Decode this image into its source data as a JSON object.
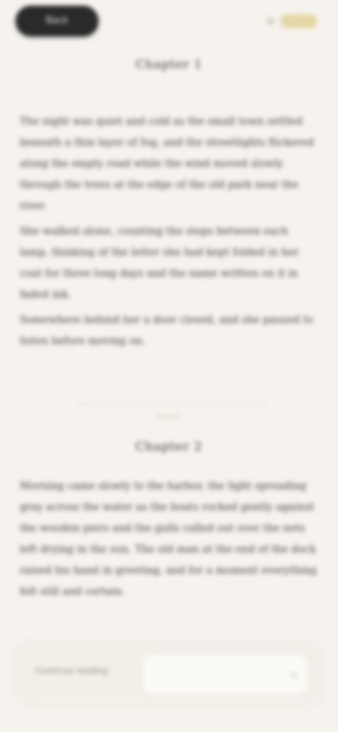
{
  "header": {
    "back_label": "Back",
    "title_first": "Chapter 1",
    "title_second": "Chapter 2"
  },
  "section_one": {
    "paragraphs": [
      "The night was quiet and cold as the small town settled beneath a thin layer of fog, and the streetlights flickered along the empty road while the wind moved slowly through the trees at the edge of the old park near the river.",
      "She walked alone, counting the steps between each lamp, thinking of the letter she had kept folded in her coat for three long days and the name written on it in faded ink.",
      "Somewhere behind her a door closed, and she paused to listen before moving on."
    ]
  },
  "section_two": {
    "paragraphs": [
      "Morning came slowly to the harbor, the light spreading gray across the water as the boats rocked gently against the wooden piers and the gulls called out over the nets left drying in the sun. The old man at the end of the dock raised his hand in greeting, and for a moment everything felt still and certain."
    ]
  },
  "bottom_bar": {
    "hint_text": "Continue reading",
    "input_placeholder": ""
  },
  "colors": {
    "background": "#f6f3ee",
    "text": "#3b3a36",
    "back_pill": "#2a2a2a",
    "accent": "#e4d7a6"
  }
}
